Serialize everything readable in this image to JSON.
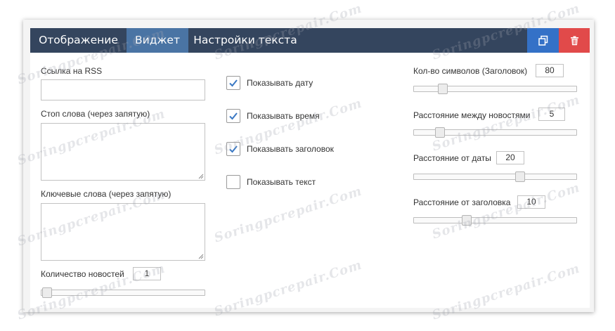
{
  "tabs": [
    {
      "label": "Отображение",
      "active": false
    },
    {
      "label": "Виджет",
      "active": true
    },
    {
      "label": "Настройки текста",
      "active": false
    }
  ],
  "toolbar": {
    "copy_icon": "copy-icon",
    "delete_icon": "trash-icon"
  },
  "left": {
    "rss_label": "Ссылка на RSS",
    "rss_value": "",
    "stopwords_label": "Стоп слова (через запятую)",
    "stopwords_value": "",
    "keywords_label": "Ключевые слова (через запятую)",
    "keywords_value": "",
    "count_label": "Количество новостей",
    "count_value": "1"
  },
  "checkboxes": [
    {
      "label": "Показывать дату",
      "checked": true
    },
    {
      "label": "Показывать время",
      "checked": true
    },
    {
      "label": "Показывать заголовок",
      "checked": true
    },
    {
      "label": "Показывать текст",
      "checked": false
    }
  ],
  "right": [
    {
      "label": "Кол-во символов (Заголовок)",
      "value": "80"
    },
    {
      "label": "Расстояние между новостями",
      "value": "5"
    },
    {
      "label": "Расстояние от даты",
      "value": "20"
    },
    {
      "label": "Расстояние от заголовка",
      "value": "10"
    }
  ],
  "watermark": "Soringpcrepair.Com",
  "colors": {
    "tabbar": "#34455e",
    "tab_active": "#4a74a4",
    "copy_button": "#3471c7",
    "delete_button": "#e14a4a"
  }
}
